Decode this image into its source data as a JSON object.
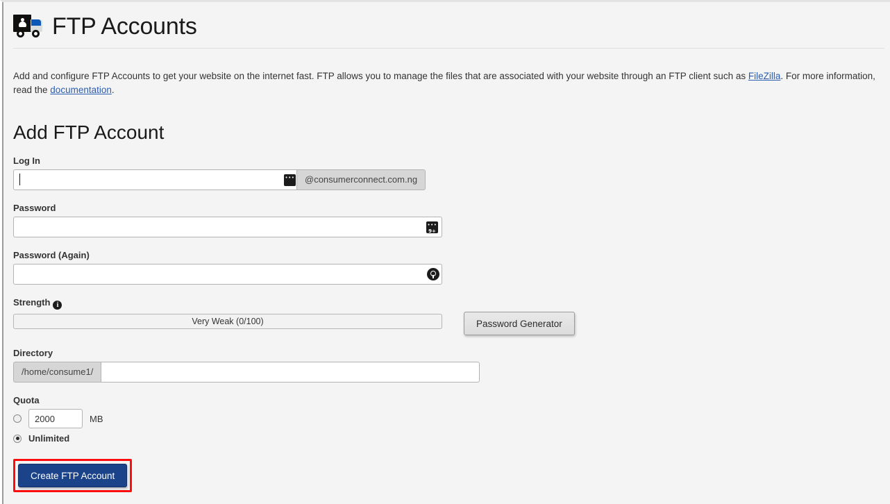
{
  "header": {
    "title": "FTP Accounts",
    "icon": "ftp-truck-icon"
  },
  "intro": {
    "part1": "Add and configure FTP Accounts to get your website on the internet fast. FTP allows you to manage the files that are associated with your website through an FTP client such as ",
    "link1": "FileZilla",
    "part2": ". For more information, read the ",
    "link2": "documentation",
    "part3": "."
  },
  "form": {
    "section_title": "Add FTP Account",
    "login": {
      "label": "Log In",
      "value": "",
      "placeholder": "",
      "domain_suffix": "@consumerconnect.com.ng",
      "field_icon": "password-manager-icon"
    },
    "password": {
      "label": "Password",
      "value": "",
      "placeholder": "",
      "field_icon": "password-manager-badge-icon",
      "badge_count": "9+"
    },
    "password_again": {
      "label": "Password (Again)",
      "value": "",
      "placeholder": "",
      "field_icon": "password-manager-round-icon"
    },
    "strength": {
      "label": "Strength",
      "info_icon": "info-icon",
      "info_glyph": "i",
      "value_text": "Very Weak (0/100)",
      "score": 0,
      "max_score": 100,
      "generator_button": "Password Generator"
    },
    "directory": {
      "label": "Directory",
      "prefix": "/home/consume1/",
      "value": "",
      "placeholder": ""
    },
    "quota": {
      "label": "Quota",
      "amount_value": "2000",
      "unit": "MB",
      "amount_selected": false,
      "unlimited_label": "Unlimited",
      "unlimited_selected": true
    },
    "submit": {
      "label": "Create FTP Account",
      "highlight_color": "#fd0d0d",
      "button_color": "#1a4389"
    }
  }
}
